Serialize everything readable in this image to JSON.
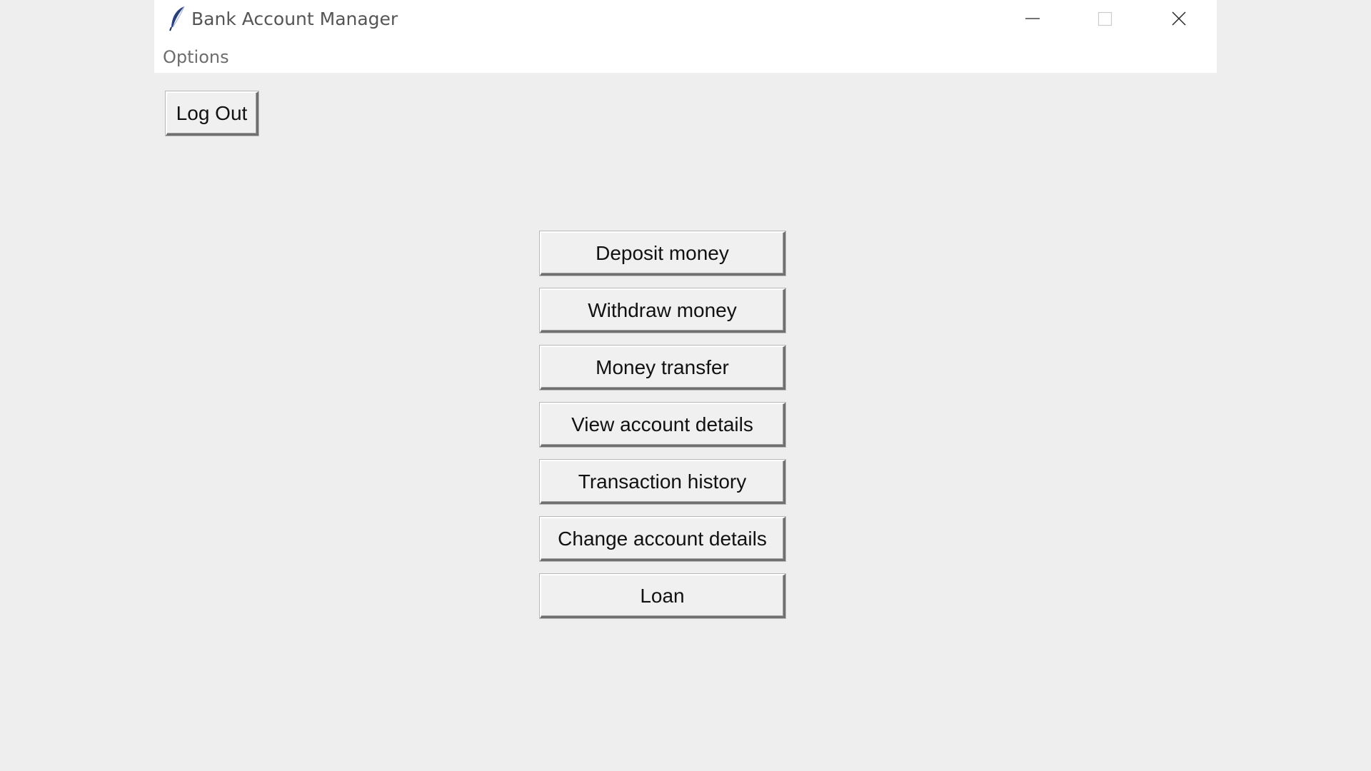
{
  "window": {
    "title": "Bank Account Manager",
    "icon": "feather-icon",
    "controls": [
      "minimize-icon",
      "maximize-icon",
      "close-icon"
    ]
  },
  "menu": {
    "items": [
      "Options"
    ]
  },
  "toolbar": {
    "logout_label": "Log Out"
  },
  "actions": [
    "Deposit money",
    "Withdraw money",
    "Money transfer",
    "View account details",
    "Transaction history",
    "Change account details",
    "Loan"
  ],
  "colors": {
    "background": "#eeeeee",
    "titlebar": "#ffffff",
    "button_face": "#f0f0f0",
    "text": "#111111"
  }
}
